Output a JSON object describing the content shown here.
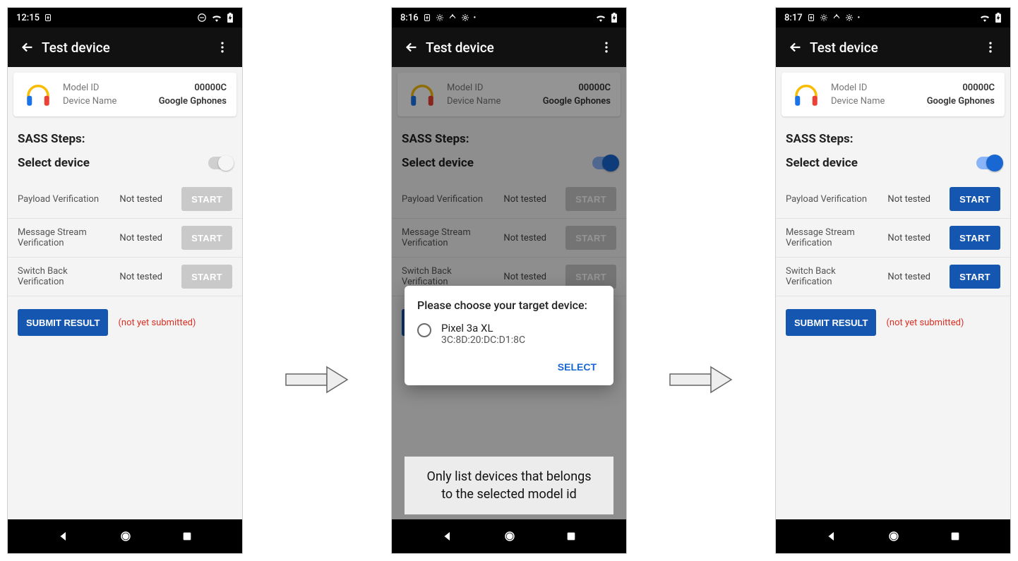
{
  "appbar": {
    "title": "Test device"
  },
  "card": {
    "model_id_label": "Model ID",
    "model_id_value": "00000C",
    "device_name_label": "Device Name",
    "device_name_value": "Google Gphones"
  },
  "sass_title": "SASS Steps:",
  "select_device_label": "Select device",
  "steps": [
    {
      "name": "Payload Verification",
      "status": "Not tested",
      "btn": "START"
    },
    {
      "name": "Message Stream Verification",
      "status": "Not tested",
      "btn": "START"
    },
    {
      "name": "Switch Back Verification",
      "status": "Not tested",
      "btn": "START"
    }
  ],
  "submit": {
    "label": "SUBMIT RESULT",
    "hint": "(not yet submitted)"
  },
  "phones": {
    "p1": {
      "time": "12:15",
      "toggle_on": false
    },
    "p2": {
      "time": "8:16",
      "toggle_on": true
    },
    "p3": {
      "time": "8:17",
      "toggle_on": true
    }
  },
  "dialog": {
    "title": "Please choose your target device:",
    "option": {
      "name": "Pixel 3a XL",
      "mac": "3C:8D:20:DC:D1:8C"
    },
    "select": "SELECT"
  },
  "caption": "Only list devices that belongs to the selected model id"
}
